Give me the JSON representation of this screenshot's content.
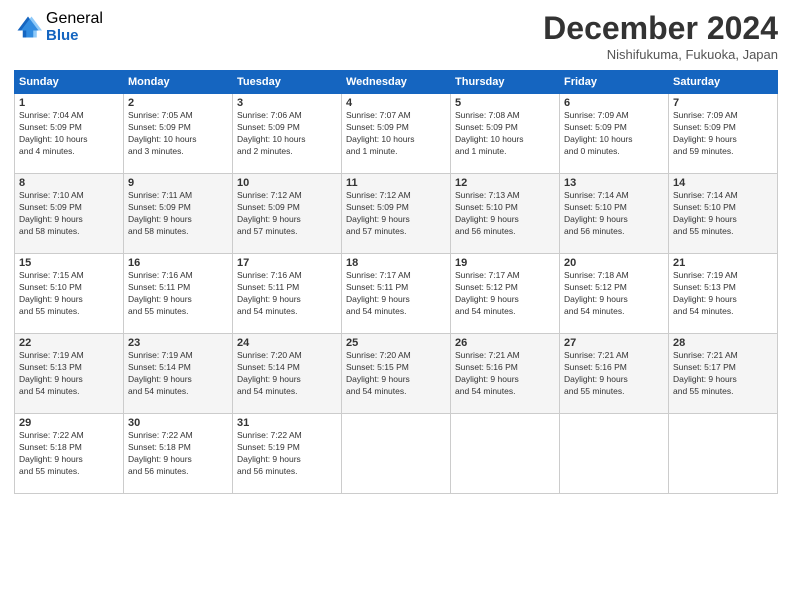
{
  "logo": {
    "general": "General",
    "blue": "Blue"
  },
  "title": "December 2024",
  "location": "Nishifukuma, Fukuoka, Japan",
  "days": [
    "Sunday",
    "Monday",
    "Tuesday",
    "Wednesday",
    "Thursday",
    "Friday",
    "Saturday"
  ],
  "weeks": [
    [
      {
        "day": 1,
        "sunrise": "7:04 AM",
        "sunset": "5:09 PM",
        "daylight": "10 hours and 4 minutes."
      },
      {
        "day": 2,
        "sunrise": "7:05 AM",
        "sunset": "5:09 PM",
        "daylight": "10 hours and 3 minutes."
      },
      {
        "day": 3,
        "sunrise": "7:06 AM",
        "sunset": "5:09 PM",
        "daylight": "10 hours and 2 minutes."
      },
      {
        "day": 4,
        "sunrise": "7:07 AM",
        "sunset": "5:09 PM",
        "daylight": "10 hours and 1 minute."
      },
      {
        "day": 5,
        "sunrise": "7:08 AM",
        "sunset": "5:09 PM",
        "daylight": "10 hours and 1 minute."
      },
      {
        "day": 6,
        "sunrise": "7:09 AM",
        "sunset": "5:09 PM",
        "daylight": "10 hours and 0 minutes."
      },
      {
        "day": 7,
        "sunrise": "7:09 AM",
        "sunset": "5:09 PM",
        "daylight": "9 hours and 59 minutes."
      }
    ],
    [
      {
        "day": 8,
        "sunrise": "7:10 AM",
        "sunset": "5:09 PM",
        "daylight": "9 hours and 58 minutes."
      },
      {
        "day": 9,
        "sunrise": "7:11 AM",
        "sunset": "5:09 PM",
        "daylight": "9 hours and 58 minutes."
      },
      {
        "day": 10,
        "sunrise": "7:12 AM",
        "sunset": "5:09 PM",
        "daylight": "9 hours and 57 minutes."
      },
      {
        "day": 11,
        "sunrise": "7:12 AM",
        "sunset": "5:09 PM",
        "daylight": "9 hours and 57 minutes."
      },
      {
        "day": 12,
        "sunrise": "7:13 AM",
        "sunset": "5:10 PM",
        "daylight": "9 hours and 56 minutes."
      },
      {
        "day": 13,
        "sunrise": "7:14 AM",
        "sunset": "5:10 PM",
        "daylight": "9 hours and 56 minutes."
      },
      {
        "day": 14,
        "sunrise": "7:14 AM",
        "sunset": "5:10 PM",
        "daylight": "9 hours and 55 minutes."
      }
    ],
    [
      {
        "day": 15,
        "sunrise": "7:15 AM",
        "sunset": "5:10 PM",
        "daylight": "9 hours and 55 minutes."
      },
      {
        "day": 16,
        "sunrise": "7:16 AM",
        "sunset": "5:11 PM",
        "daylight": "9 hours and 55 minutes."
      },
      {
        "day": 17,
        "sunrise": "7:16 AM",
        "sunset": "5:11 PM",
        "daylight": "9 hours and 54 minutes."
      },
      {
        "day": 18,
        "sunrise": "7:17 AM",
        "sunset": "5:11 PM",
        "daylight": "9 hours and 54 minutes."
      },
      {
        "day": 19,
        "sunrise": "7:17 AM",
        "sunset": "5:12 PM",
        "daylight": "9 hours and 54 minutes."
      },
      {
        "day": 20,
        "sunrise": "7:18 AM",
        "sunset": "5:12 PM",
        "daylight": "9 hours and 54 minutes."
      },
      {
        "day": 21,
        "sunrise": "7:19 AM",
        "sunset": "5:13 PM",
        "daylight": "9 hours and 54 minutes."
      }
    ],
    [
      {
        "day": 22,
        "sunrise": "7:19 AM",
        "sunset": "5:13 PM",
        "daylight": "9 hours and 54 minutes."
      },
      {
        "day": 23,
        "sunrise": "7:19 AM",
        "sunset": "5:14 PM",
        "daylight": "9 hours and 54 minutes."
      },
      {
        "day": 24,
        "sunrise": "7:20 AM",
        "sunset": "5:14 PM",
        "daylight": "9 hours and 54 minutes."
      },
      {
        "day": 25,
        "sunrise": "7:20 AM",
        "sunset": "5:15 PM",
        "daylight": "9 hours and 54 minutes."
      },
      {
        "day": 26,
        "sunrise": "7:21 AM",
        "sunset": "5:16 PM",
        "daylight": "9 hours and 54 minutes."
      },
      {
        "day": 27,
        "sunrise": "7:21 AM",
        "sunset": "5:16 PM",
        "daylight": "9 hours and 55 minutes."
      },
      {
        "day": 28,
        "sunrise": "7:21 AM",
        "sunset": "5:17 PM",
        "daylight": "9 hours and 55 minutes."
      }
    ],
    [
      {
        "day": 29,
        "sunrise": "7:22 AM",
        "sunset": "5:18 PM",
        "daylight": "9 hours and 55 minutes."
      },
      {
        "day": 30,
        "sunrise": "7:22 AM",
        "sunset": "5:18 PM",
        "daylight": "9 hours and 56 minutes."
      },
      {
        "day": 31,
        "sunrise": "7:22 AM",
        "sunset": "5:19 PM",
        "daylight": "9 hours and 56 minutes."
      },
      null,
      null,
      null,
      null
    ]
  ]
}
